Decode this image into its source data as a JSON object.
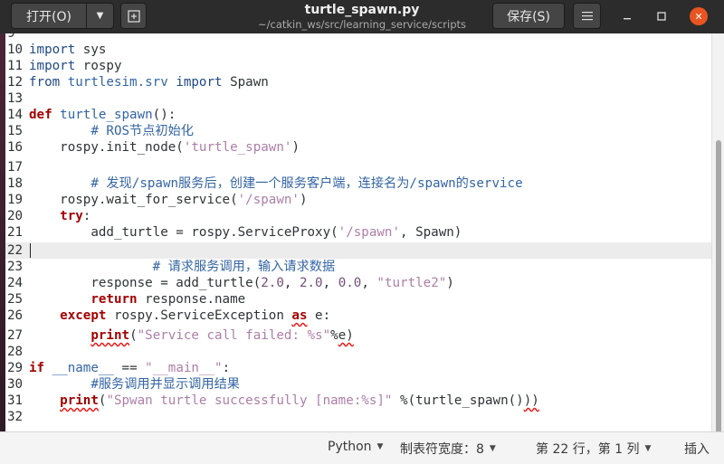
{
  "window": {
    "title": "turtle_spawn.py",
    "subtitle": "~/catkin_ws/src/learning_service/scripts"
  },
  "header": {
    "open_label": "打开(O)",
    "save_label": "保存(S)"
  },
  "icons": {
    "open_menu": "chevron-down-icon",
    "new_tab": "new-tab-icon",
    "menu": "hamburger-menu-icon",
    "minimize": "minimize-icon",
    "maximize": "maximize-icon",
    "close": "close-icon"
  },
  "colors": {
    "keyword": "#a40000",
    "comment": "#3465a4",
    "string": "#ad7fa8",
    "number": "#75507b",
    "close_button": "#e95420",
    "header_bg": "#2c2c2c"
  },
  "editor": {
    "current_line": 22,
    "lines": [
      {
        "n": "9",
        "tokens": []
      },
      {
        "n": "10",
        "tokens": [
          {
            "t": "import",
            "c": "st"
          },
          {
            "t": " sys"
          }
        ]
      },
      {
        "n": "11",
        "tokens": [
          {
            "t": "import",
            "c": "st"
          },
          {
            "t": " rospy"
          }
        ]
      },
      {
        "n": "12",
        "tokens": [
          {
            "t": "from",
            "c": "st"
          },
          {
            "t": " "
          },
          {
            "t": "turtlesim.srv",
            "c": "fn"
          },
          {
            "t": " "
          },
          {
            "t": "import",
            "c": "st"
          },
          {
            "t": " Spawn"
          }
        ]
      },
      {
        "n": "13",
        "tokens": []
      },
      {
        "n": "14",
        "tokens": [
          {
            "t": "def",
            "c": "kw"
          },
          {
            "t": " "
          },
          {
            "t": "turtle_spawn",
            "c": "fn"
          },
          {
            "t": "():"
          }
        ]
      },
      {
        "n": "15",
        "tokens": [
          {
            "t": "        # ROS节点初始化",
            "c": "cm"
          }
        ]
      },
      {
        "n": "16",
        "tokens": [
          {
            "t": "    rospy.init_node("
          },
          {
            "t": "'turtle_spawn'",
            "c": "str"
          },
          {
            "t": ")"
          }
        ]
      },
      {
        "n": "17",
        "tokens": []
      },
      {
        "n": "18",
        "tokens": [
          {
            "t": "        # 发现/spawn服务后，创建一个服务客户端，连接名为/spawn的service",
            "c": "cm"
          }
        ]
      },
      {
        "n": "19",
        "tokens": [
          {
            "t": "    rospy.wait_for_service("
          },
          {
            "t": "'/spawn'",
            "c": "str"
          },
          {
            "t": ")"
          }
        ]
      },
      {
        "n": "20",
        "tokens": [
          {
            "t": "    "
          },
          {
            "t": "try",
            "c": "kw"
          },
          {
            "t": ":"
          }
        ]
      },
      {
        "n": "21",
        "tokens": [
          {
            "t": "        add_turtle = rospy.ServiceProxy("
          },
          {
            "t": "'/spawn'",
            "c": "str"
          },
          {
            "t": ", Spawn)"
          }
        ]
      },
      {
        "n": "22",
        "tokens": []
      },
      {
        "n": "23",
        "tokens": [
          {
            "t": "                # 请求服务调用，输入请求数据",
            "c": "cm"
          }
        ]
      },
      {
        "n": "24",
        "tokens": [
          {
            "t": "        response = add_turtle("
          },
          {
            "t": "2.0",
            "c": "num"
          },
          {
            "t": ", "
          },
          {
            "t": "2.0",
            "c": "num"
          },
          {
            "t": ", "
          },
          {
            "t": "0.0",
            "c": "num"
          },
          {
            "t": ", "
          },
          {
            "t": "\"turtle2\"",
            "c": "str"
          },
          {
            "t": ")"
          }
        ]
      },
      {
        "n": "25",
        "tokens": [
          {
            "t": "        "
          },
          {
            "t": "return",
            "c": "kw"
          },
          {
            "t": " response.name"
          }
        ]
      },
      {
        "n": "26",
        "tokens": [
          {
            "t": "    "
          },
          {
            "t": "except",
            "c": "kw"
          },
          {
            "t": " rospy.ServiceException "
          },
          {
            "t": "as",
            "c": "kw squig"
          },
          {
            "t": " e:"
          }
        ]
      },
      {
        "n": "27",
        "tokens": [
          {
            "t": "        "
          },
          {
            "t": "print",
            "c": "kw squig"
          },
          {
            "t": "("
          },
          {
            "t": "\"Service call failed: %s\"",
            "c": "str"
          },
          {
            "t": "%"
          },
          {
            "t": "e)",
            "c": "squig"
          }
        ]
      },
      {
        "n": "28",
        "tokens": []
      },
      {
        "n": "29",
        "tokens": [
          {
            "t": "if",
            "c": "kw"
          },
          {
            "t": " "
          },
          {
            "t": "__name__",
            "c": "fn"
          },
          {
            "t": " == "
          },
          {
            "t": "\"__main__\"",
            "c": "str"
          },
          {
            "t": ":"
          }
        ]
      },
      {
        "n": "30",
        "tokens": [
          {
            "t": "        #服务调用并显示调用结果",
            "c": "cm"
          }
        ]
      },
      {
        "n": "31",
        "tokens": [
          {
            "t": "    "
          },
          {
            "t": "print",
            "c": "kw squig"
          },
          {
            "t": "("
          },
          {
            "t": "\"Spwan turtle successfully [name:%s]\"",
            "c": "str"
          },
          {
            "t": " %(turtle_spawn()"
          },
          {
            "t": "))",
            "c": "squig"
          }
        ]
      },
      {
        "n": "32",
        "tokens": []
      }
    ]
  },
  "statusbar": {
    "language": "Python",
    "tab_width": "制表符宽度：8",
    "position": "第 22 行，第 1 列",
    "mode": "插入"
  }
}
